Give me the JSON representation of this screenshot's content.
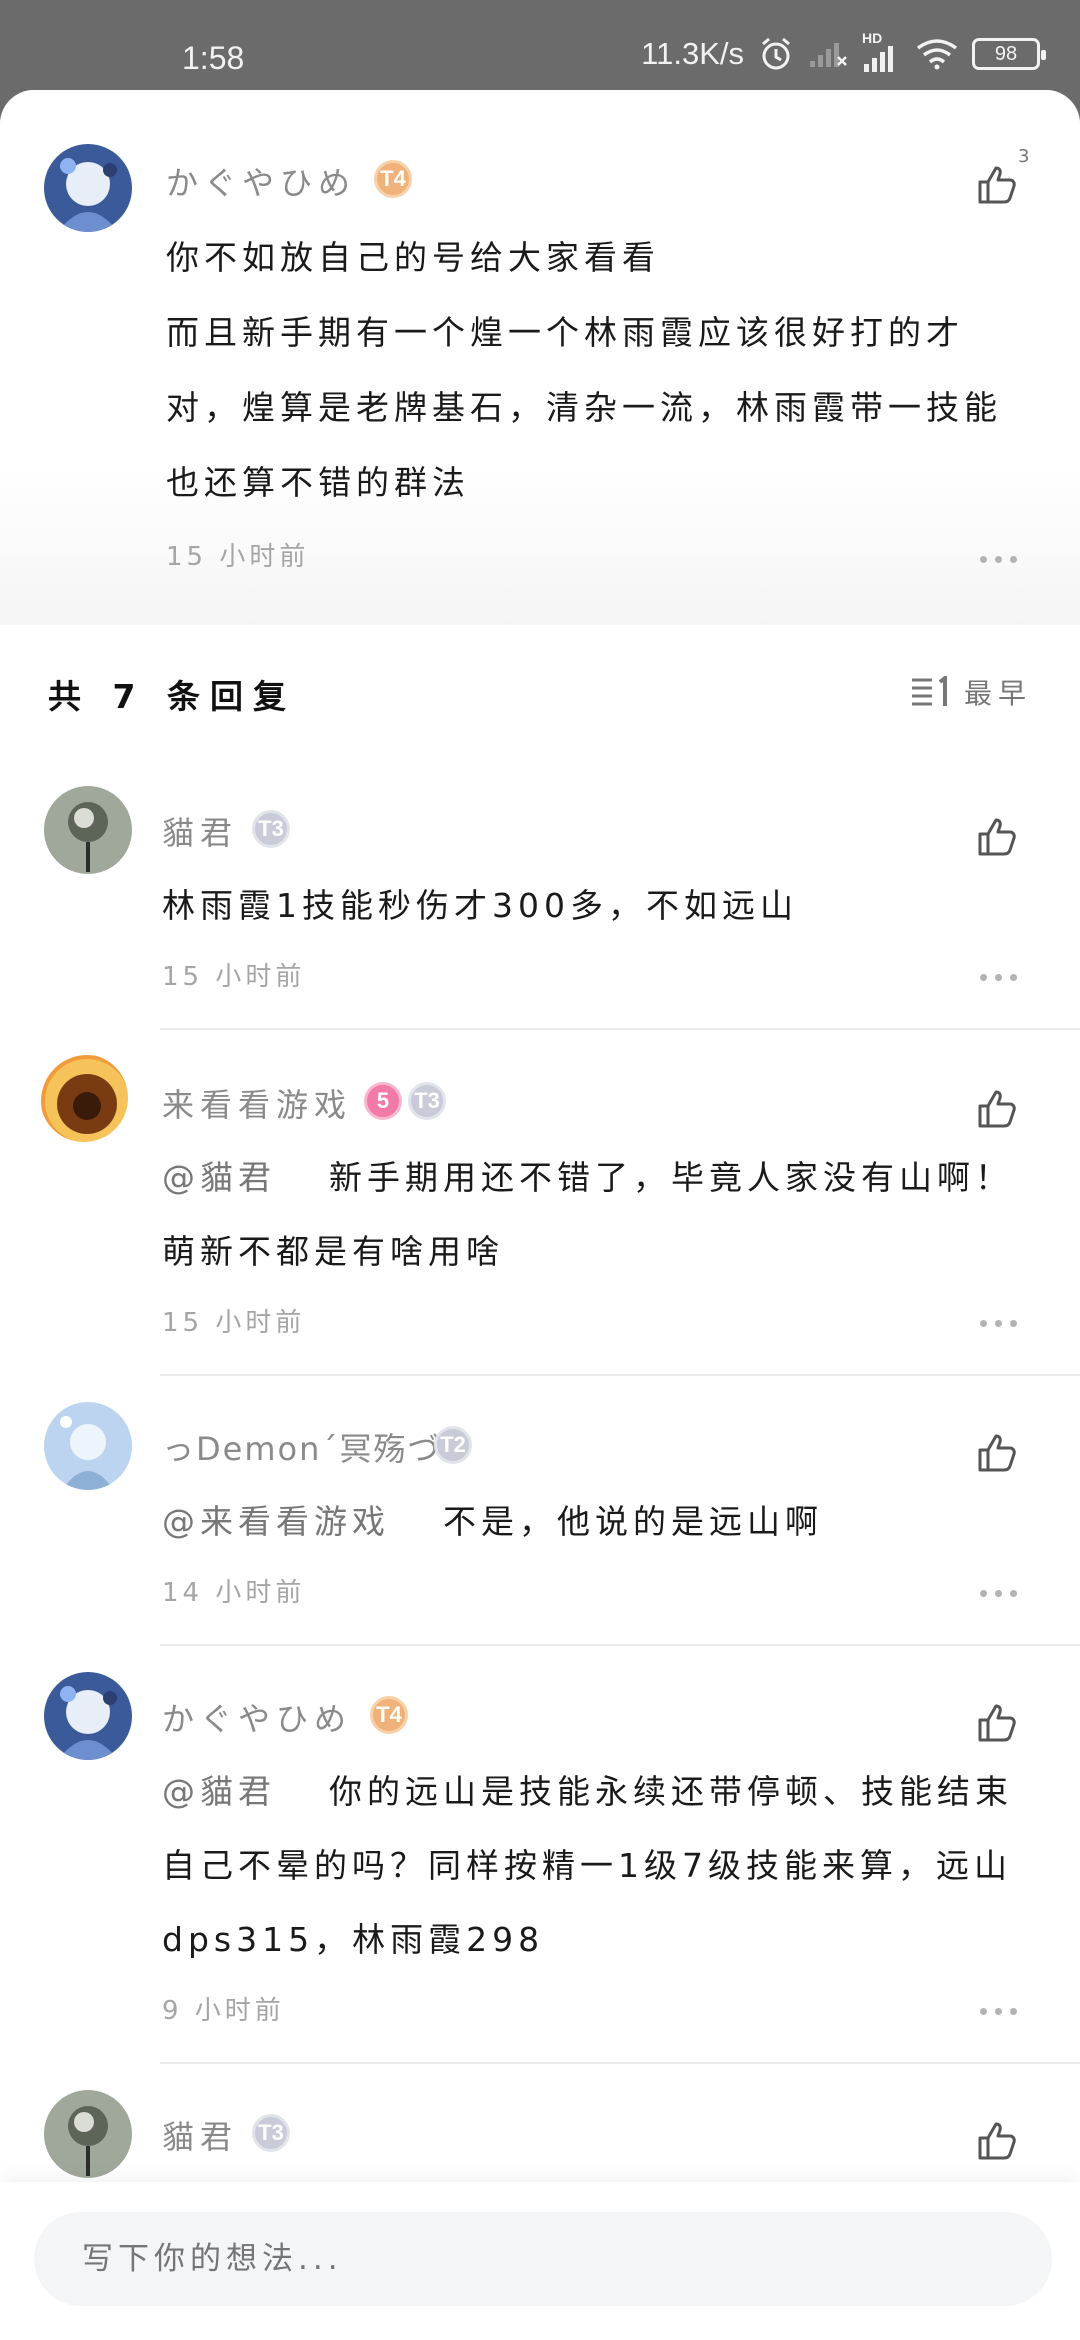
{
  "status_bar": {
    "time": "1:58",
    "net_speed": "11.3K/s",
    "network_type": "HD",
    "battery": "98"
  },
  "main_comment": {
    "username": "かぐやひめ",
    "badge": "T4",
    "likes": "3",
    "lines": [
      "你不如放自己的号给大家看看",
      "而且新手期有一个煌一个林雨霞应该很好打的才",
      "对，煌算是老牌基石，清杂一流，林雨霞带一技能",
      "也还算不错的群法"
    ],
    "time": "15 小时前"
  },
  "replies_header": {
    "title": "共 7 条回复",
    "sort_label": "最早"
  },
  "replies": [
    {
      "username": "貓君",
      "badge": "T3",
      "mention": "",
      "lines": [
        "林雨霞1技能秒伤才300多，不如远山"
      ],
      "time": "15 小时前"
    },
    {
      "username": "来看看游戏",
      "badge_extra": "5",
      "badge": "T3",
      "mention": "@貓君",
      "lines": [
        "新手期用还不错了，毕竟人家没有山啊！",
        "萌新不都是有啥用啥"
      ],
      "time": "15 小时前"
    },
    {
      "username": "っDemon´冥殇づ",
      "badge": "T2",
      "mention": "@来看看游戏",
      "lines": [
        "不是，他说的是远山啊"
      ],
      "time": "14 小时前"
    },
    {
      "username": "かぐやひめ",
      "badge": "T4",
      "mention": "@貓君",
      "lines": [
        "你的远山是技能永续还带停顿、技能结束",
        "自己不晕的吗？同样按精一1级7级技能来算，远山",
        "dps315，林雨霞298"
      ],
      "time": "9 小时前"
    },
    {
      "username": "貓君",
      "badge": "T3"
    }
  ],
  "input": {
    "placeholder": "写下你的想法..."
  },
  "colors": {
    "gold_badge": "#f0b27a",
    "silver_badge": "#c9ccd8",
    "pink_badge": "#f27aa6"
  }
}
